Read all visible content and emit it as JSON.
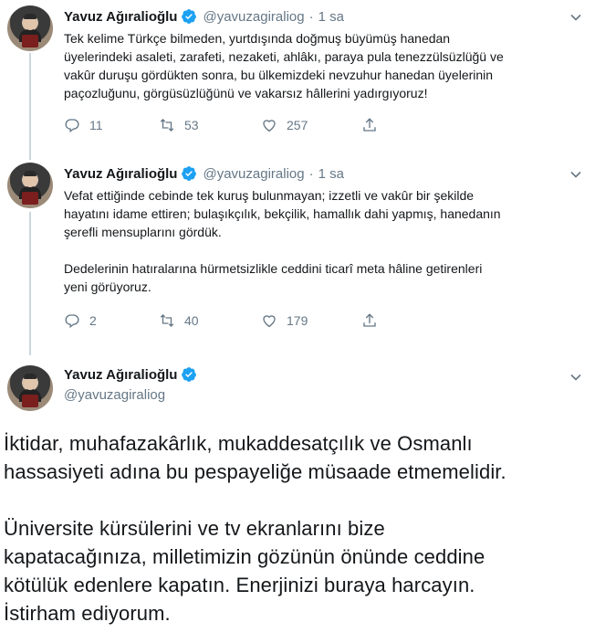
{
  "tweets": [
    {
      "name": "Yavuz Ağıralioğlu",
      "handle": "@yavuzagiraliog",
      "separator": "·",
      "time": "1 sa",
      "text": "Tek kelime Türkçe bilmeden, yurtdışında doğmuş büyümüş hanedan\nüyelerindeki asaleti, zarafeti, nezaketi, ahlâkı, paraya pula tenezzülsüzlüğü ve\nvakûr duruşu gördükten sonra, bu ülkemizdeki nevzuhur hanedan üyelerinin\npaçozluğunu, görgüsüzlüğünü ve vakarsız hâllerini yadırgıyoruz!",
      "replies": "11",
      "retweets": "53",
      "likes": "257"
    },
    {
      "name": "Yavuz Ağıralioğlu",
      "handle": "@yavuzagiraliog",
      "separator": "·",
      "time": "1 sa",
      "text": "Vefat ettiğinde cebinde tek kuruş bulunmayan; izzetli ve vakûr bir şekilde\nhayatını idame ettiren; bulaşıkçılık, bekçilik, hamallık dahi yapmış, hanedanın\nşerefli mensuplarını gördük.\n\nDedelerinin hatıralarına hürmetsizlikle ceddini ticarî meta hâline getirenleri\nyeni görüyoruz.",
      "replies": "2",
      "retweets": "40",
      "likes": "179"
    }
  ],
  "main_tweet": {
    "name": "Yavuz Ağıralioğlu",
    "handle": "@yavuzagiraliog",
    "text": "İktidar, muhafazakârlık, mukaddesatçılık ve Osmanlı\nhassasiyeti adına bu pespayeliğe müsaade etmemelidir.\n\nÜniversite kürsülerini ve tv ekranlarını bize\nkapatacağınıza, milletimizin gözünün önünde ceddine\nkötülük edenlere kapatın. Enerjinizi buraya harcayın.\nİstirham ediyorum."
  },
  "icons": {
    "verified": "verified-badge-icon",
    "reply": "reply-icon",
    "retweet": "retweet-icon",
    "like": "heart-icon",
    "share": "share-icon",
    "caret": "chevron-down-icon"
  },
  "colors": {
    "accent": "#1da1f2",
    "muted": "#657786",
    "text": "#14171a",
    "thread": "#ccd6dd"
  }
}
